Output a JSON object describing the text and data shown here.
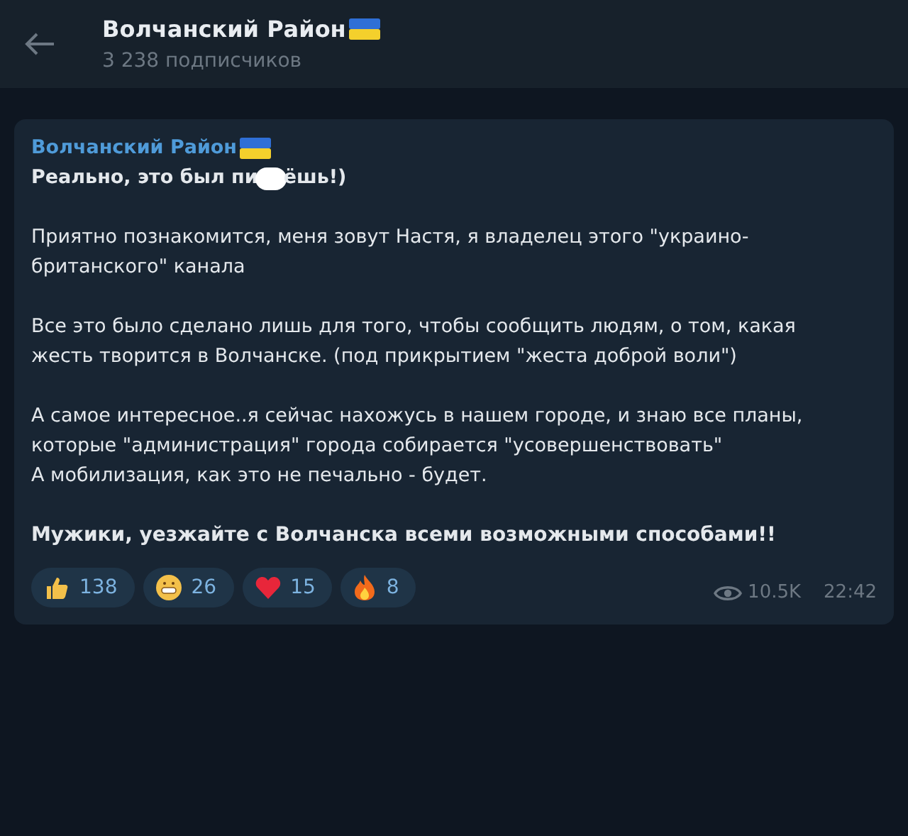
{
  "header": {
    "title": "Волчанский Район",
    "subtitle": "3 238 подписчиков"
  },
  "message": {
    "author": "Волчанский Район",
    "headline_before": "Реально, это был пи",
    "headline_after": "ёшь!)",
    "paragraphs": [
      {
        "kind": "text",
        "lines": [
          "Приятно познакомится, меня зовут Настя, я владелец этого \"украино-британского\" канала"
        ]
      },
      {
        "kind": "text",
        "lines": [
          "Все это было сделано лишь для того, чтобы сообщить людям, о том, какая жесть творится в Волчанске. (под прикрытием \"жеста доброй воли\")"
        ]
      },
      {
        "kind": "text",
        "lines": [
          "А самое интересное..я сейчас нахожусь в нашем городе, и знаю все планы, которые \"администрация\" города собирается \"усовершенствовать\"",
          "А мобилизация, как это не печально - будет."
        ]
      },
      {
        "kind": "bold",
        "lines": [
          "Мужики, уезжайте с Волчанска всеми возможными способами!!"
        ]
      }
    ],
    "reactions": [
      {
        "kind": "thumb",
        "count": "138"
      },
      {
        "kind": "grin",
        "count": "26"
      },
      {
        "kind": "heart",
        "count": "15"
      },
      {
        "kind": "fire",
        "count": "8"
      }
    ],
    "views": "10.5K",
    "time": "22:42"
  }
}
